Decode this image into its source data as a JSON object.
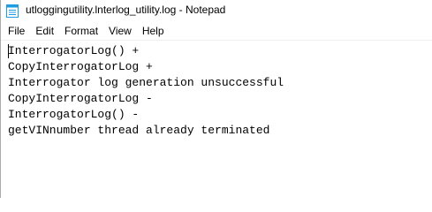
{
  "window": {
    "title": "utloggingutility.lnterlog_utility.log - Notepad"
  },
  "menu": {
    "items": [
      "File",
      "Edit",
      "Format",
      "View",
      "Help"
    ]
  },
  "editor": {
    "lines": [
      "InterrogatorLog() +",
      "CopyInterrogatorLog +",
      "Interrogator log generation unsuccessful",
      "CopyInterrogatorLog -",
      "InterrogatorLog() -",
      "getVINnumber thread already terminated"
    ]
  },
  "icons": {
    "app": "notepad-icon"
  },
  "colors": {
    "icon_blue": "#1e9de0"
  }
}
